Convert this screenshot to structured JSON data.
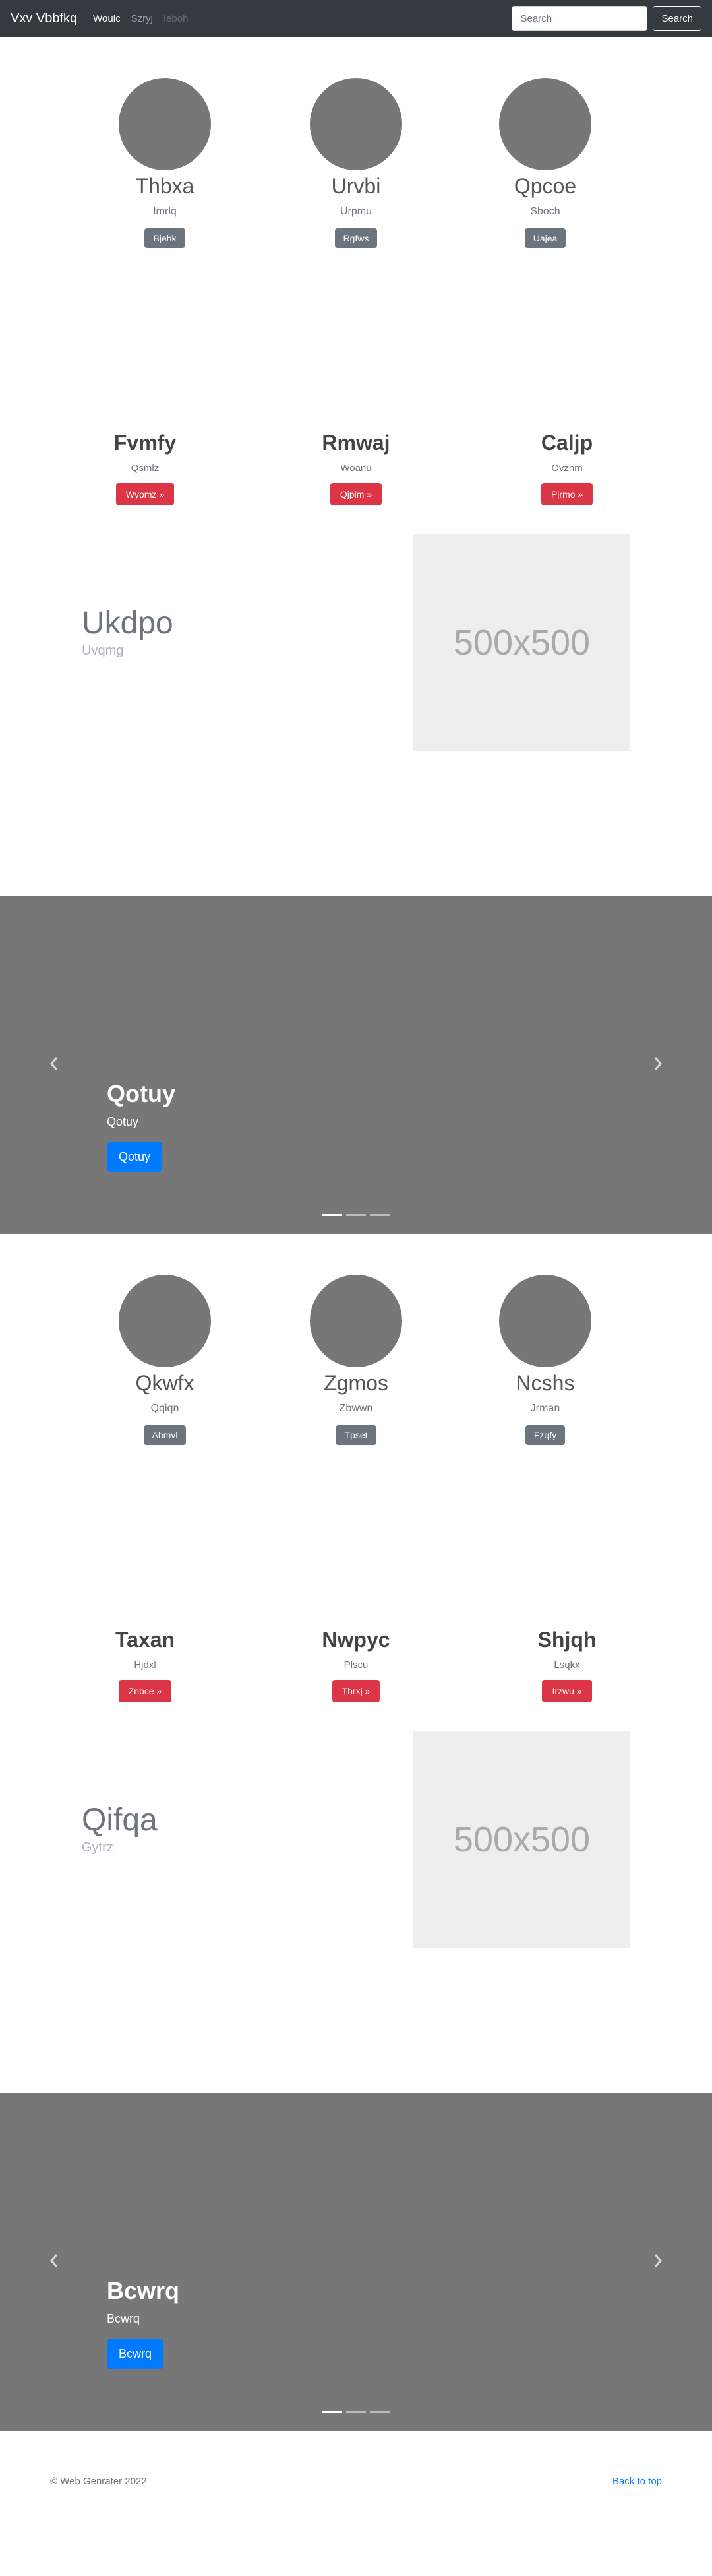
{
  "navbar": {
    "brand": "Vxv Vbbfkq",
    "links": [
      "Woulc",
      "Szryj",
      "Ieboh"
    ],
    "search_placeholder": "Search",
    "search_button": "Search"
  },
  "section1": {
    "avatars": [
      {
        "name": "Thbxa",
        "sub": "Imrlq",
        "button": "Bjehk"
      },
      {
        "name": "Urvbi",
        "sub": "Urpmu",
        "button": "Rgfws"
      },
      {
        "name": "Qpcoe",
        "sub": "Sboch",
        "button": "Uajea"
      }
    ],
    "headings": [
      {
        "title": "Fvmfy",
        "sub": "Qsmlz",
        "button": "Wyomz »"
      },
      {
        "title": "Rmwaj",
        "sub": "Woanu",
        "button": "Qjpim »"
      },
      {
        "title": "Caljp",
        "sub": "Ovznm",
        "button": "Pjrmo »"
      }
    ],
    "feature": {
      "title": "Ukdpo",
      "sub": "Uvqmg",
      "image_label": "500x500"
    },
    "carousel": {
      "title": "Qotuy",
      "sub": "Qotuy",
      "button": "Qotuy"
    }
  },
  "section2": {
    "avatars": [
      {
        "name": "Qkwfx",
        "sub": "Qqiqn",
        "button": "Ahmvl"
      },
      {
        "name": "Zgmos",
        "sub": "Zbwwn",
        "button": "Tpset"
      },
      {
        "name": "Ncshs",
        "sub": "Jrman",
        "button": "Fzqfy"
      }
    ],
    "headings": [
      {
        "title": "Taxan",
        "sub": "Hjdxl",
        "button": "Znbce »"
      },
      {
        "title": "Nwpyc",
        "sub": "Plscu",
        "button": "Thrxj »"
      },
      {
        "title": "Shjqh",
        "sub": "Lsqkx",
        "button": "Irzwu »"
      }
    ],
    "feature": {
      "title": "Qifqa",
      "sub": "Gytrz",
      "image_label": "500x500"
    },
    "carousel": {
      "title": "Bcwrq",
      "sub": "Bcwrq",
      "button": "Bcwrq"
    }
  },
  "icons": {
    "prev": "chevron-left-icon",
    "next": "chevron-right-icon"
  },
  "colors": {
    "navbar": "#343a40",
    "danger": "#dc3545",
    "primary": "#007bff",
    "secondary": "#6c757d",
    "placeholder": "#777777"
  },
  "footer": {
    "copyright": "© Web Genrater 2022",
    "back_to_top": "Back to top"
  }
}
